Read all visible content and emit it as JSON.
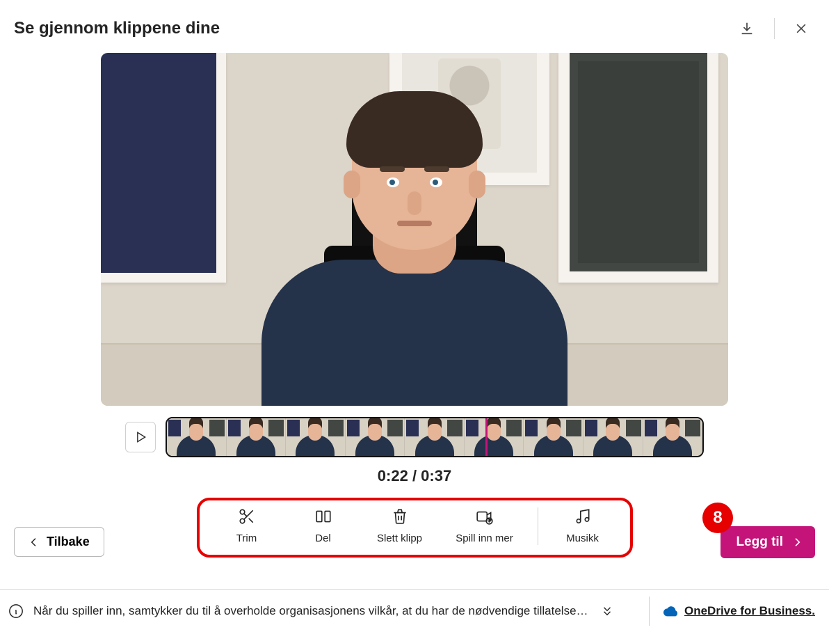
{
  "header": {
    "title": "Se gjennom klippene dine"
  },
  "timeline": {
    "thumb_count": 9,
    "playhead_percent": 59.5
  },
  "playback": {
    "current": "0:22",
    "total": "0:37"
  },
  "toolbar": {
    "trim": "Trim",
    "split": "Del",
    "delete": "Slett klipp",
    "record_more": "Spill inn mer",
    "music": "Musikk"
  },
  "buttons": {
    "back": "Tilbake",
    "add": "Legg til"
  },
  "annotation": {
    "number": "8"
  },
  "footer": {
    "message": "Når du spiller inn, samtykker du til å overholde organisasjonens vilkår, at du har de nødvendige tillatelse…",
    "onedrive": "OneDrive for Business."
  }
}
